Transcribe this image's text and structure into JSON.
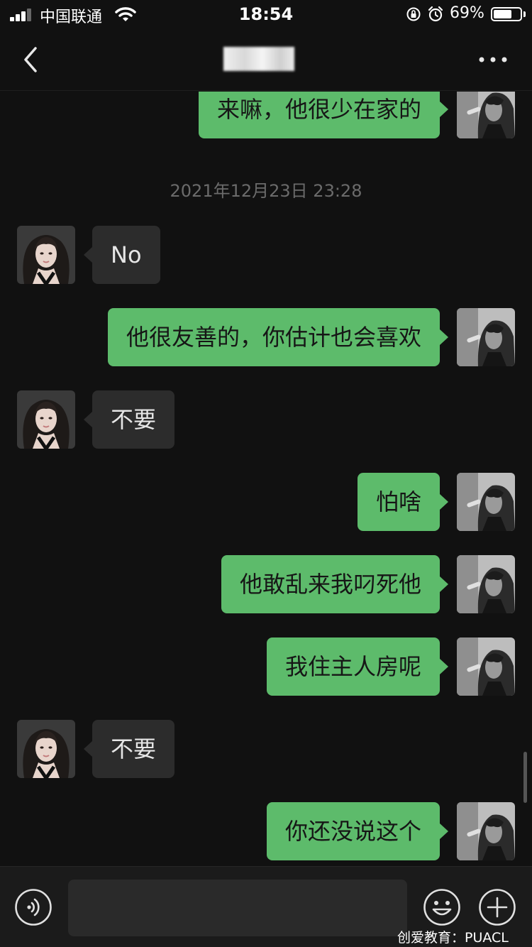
{
  "status_bar": {
    "carrier": "中国联通",
    "time": "18:54",
    "battery_percent": "69%",
    "battery_level": 0.69,
    "icons": [
      "signal-icon",
      "wifi-icon",
      "orientation-lock-icon",
      "alarm-icon",
      "battery-icon"
    ]
  },
  "nav": {
    "back_icon": "chevron-left-icon",
    "more_icon": "more-dots-icon"
  },
  "messages": [
    {
      "sender": "me",
      "text": "来嘛，他很少在家的"
    },
    {
      "type": "timestamp",
      "text": "2021年12月23日 23:28"
    },
    {
      "sender": "peer",
      "text": "No"
    },
    {
      "sender": "me",
      "text": "他很友善的，你估计也会喜欢"
    },
    {
      "sender": "peer",
      "text": "不要"
    },
    {
      "sender": "me",
      "text": "怕啥"
    },
    {
      "sender": "me",
      "text": "他敢乱来我叼死他"
    },
    {
      "sender": "me",
      "text": "我住主人房呢"
    },
    {
      "sender": "peer",
      "text": "不要"
    },
    {
      "sender": "me",
      "text": "你还没说这个"
    }
  ],
  "input_bar": {
    "voice_icon": "voice-icon",
    "emoji_icon": "emoji-icon",
    "plus_icon": "plus-icon",
    "input_value": "",
    "input_placeholder": ""
  },
  "watermark": "创爱教育：PUACL",
  "colors": {
    "background": "#111111",
    "my_bubble": "#5dbb6b",
    "peer_bubble": "#2c2c2c",
    "timestamp": "#6b6b6b"
  }
}
